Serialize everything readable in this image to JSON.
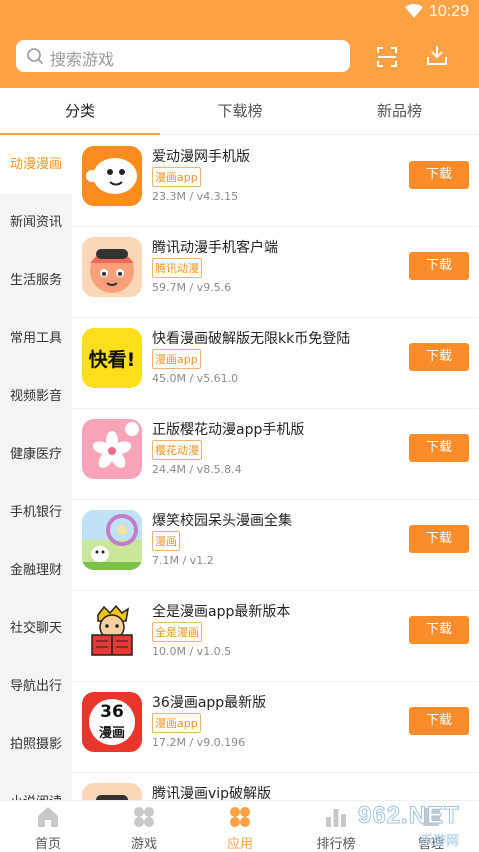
{
  "status_bar": {
    "time": "10:29"
  },
  "search": {
    "placeholder": "搜索游戏"
  },
  "tabs": [
    {
      "label": "分类",
      "active": true
    },
    {
      "label": "下载榜",
      "active": false
    },
    {
      "label": "新品榜",
      "active": false
    }
  ],
  "sidebar": {
    "items": [
      {
        "label": "动漫漫画",
        "active": true
      },
      {
        "label": "新闻资讯"
      },
      {
        "label": "生活服务"
      },
      {
        "label": "常用工具"
      },
      {
        "label": "视频影音"
      },
      {
        "label": "健康医疗"
      },
      {
        "label": "手机银行"
      },
      {
        "label": "金融理财"
      },
      {
        "label": "社交聊天"
      },
      {
        "label": "导航出行"
      },
      {
        "label": "拍照摄影"
      },
      {
        "label": "小说阅读"
      }
    ]
  },
  "apps": [
    {
      "name": "爱动漫网手机版",
      "tag": "漫画app",
      "meta": "23.3M / v4.3.15",
      "button": "下载",
      "icon": "aidongman-icon"
    },
    {
      "name": "腾讯动漫手机客户端",
      "tag": "腾讯动漫",
      "meta": "59.7M / v9.5.6",
      "button": "下载",
      "icon": "tencent-comic-icon"
    },
    {
      "name": "快看漫画破解版无限kk币免登陆",
      "tag": "漫画app",
      "meta": "45.0M / v5.61.0",
      "button": "下载",
      "icon": "kuaikan-icon",
      "icon_text": "快看!"
    },
    {
      "name": "正版樱花动漫app手机版",
      "tag": "樱花动漫",
      "meta": "24.4M / v8.5.8.4",
      "button": "下载",
      "icon": "sakura-icon"
    },
    {
      "name": "爆笑校园呆头漫画全集",
      "tag": "漫画",
      "meta": "7.1M / v1.2",
      "button": "下载",
      "icon": "baoxiao-icon"
    },
    {
      "name": "全是漫画app最新版本",
      "tag": "全是漫画",
      "meta": "10.0M / v1.0.5",
      "button": "下载",
      "icon": "reader-icon"
    },
    {
      "name": "36漫画app最新版",
      "tag": "漫画app",
      "meta": "17.2M / v9.0.196",
      "button": "下载",
      "icon": "manhua36-icon",
      "icon_text_top": "36",
      "icon_text_bottom": "漫画"
    },
    {
      "name": "腾讯漫画vip破解版",
      "tag": "",
      "meta": "",
      "button": "",
      "icon": "tencent-comic-icon"
    }
  ],
  "bottom_nav": [
    {
      "label": "首页",
      "icon": "home-icon"
    },
    {
      "label": "游戏",
      "icon": "game-icon"
    },
    {
      "label": "应用",
      "icon": "apps-icon",
      "active": true
    },
    {
      "label": "排行榜",
      "icon": "ranking-icon"
    },
    {
      "label": "管理",
      "icon": "manage-icon"
    }
  ],
  "watermark": {
    "text": "962.NET",
    "sub": "乐游网"
  },
  "colors": {
    "accent": "#fca243",
    "button": "#fb8c2a",
    "active_side": "#f0931a"
  }
}
